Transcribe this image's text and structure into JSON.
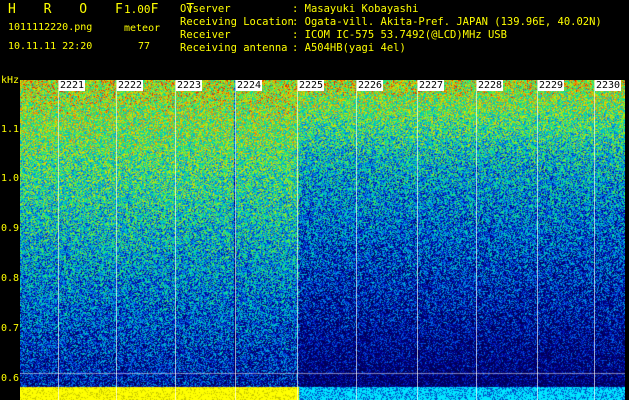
{
  "header": {
    "app_title": "H R O F F T",
    "version": "1.00",
    "filename": "1011112220.png",
    "mode": "meteor",
    "datetime": "10.11.11 22:20",
    "count": "77"
  },
  "info": [
    {
      "key": "Ovserver",
      "value": ": Masayuki Kobayashi"
    },
    {
      "key": "Receiving Location",
      "value": ": Ogata-vill. Akita-Pref. JAPAN (139.96E, 40.02N)"
    },
    {
      "key": "Receiver",
      "value": ": ICOM IC-575 53.7492(@LCD)MHz USB"
    },
    {
      "key": "Receiving antenna",
      "value": ": A504HB(yagi 4el)"
    }
  ],
  "spectrogram": {
    "y_unit": "kHz",
    "y_ticks": [
      "1.1",
      "1.0",
      "0.9",
      "0.8",
      "0.7",
      "0.6"
    ],
    "x_ticks": [
      "2221",
      "2222",
      "2223",
      "2224",
      "2225",
      "2226",
      "2227",
      "2228",
      "2229",
      "2230"
    ]
  }
}
